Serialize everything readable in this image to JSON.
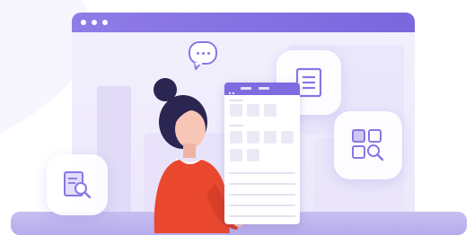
{
  "illustration": {
    "colors": {
      "primary": "#7b67de",
      "primary_light": "#8f7ce6",
      "background_tint": "#ece8fb",
      "shirt": "#e9482f",
      "hair": "#2a2551",
      "skin": "#f7c6b6"
    },
    "icons": {
      "chat_bubble": "chat-bubble-icon",
      "notes": "notes-icon",
      "grid_search": "grid-search-icon",
      "document_search": "document-search-icon"
    },
    "document": {
      "tab_1": "",
      "tab_2": "",
      "section_1": "",
      "section_2": ""
    }
  }
}
